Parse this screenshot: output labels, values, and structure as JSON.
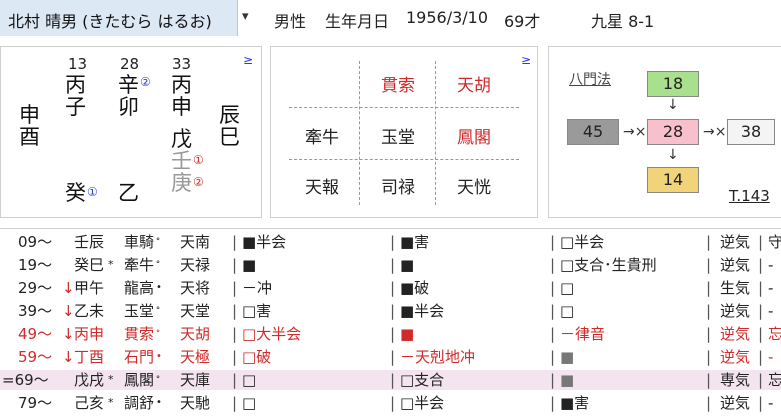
{
  "header": {
    "name": "北村 晴男 (きたむら はるお)",
    "gender": "男性",
    "birth_label": "生年月日",
    "birth_date": "1956/3/10",
    "age": "69才",
    "kyusei": "九星 8-1"
  },
  "meishiki": {
    "col1": {
      "num": "13",
      "ten": "丙",
      "chi": "子",
      "zokan": "癸",
      "mark": "①"
    },
    "col2": {
      "num": "28",
      "ten": "辛",
      "ten_mark": "②",
      "chi": "卯",
      "zokan": "乙"
    },
    "col3": {
      "num": "33",
      "ten": "丙",
      "chi": "申",
      "z1": "戊",
      "z2": "壬",
      "z2_mark": "①",
      "z3": "庚",
      "z3_mark": "②"
    },
    "kubou_left": [
      "申",
      "酉"
    ],
    "kubou_right": [
      "辰",
      "巳"
    ],
    "link_mark": "≥"
  },
  "jintai": {
    "row1": [
      "",
      "貫索",
      "天胡"
    ],
    "row2": [
      "牽牛",
      "玉堂",
      "鳳閣"
    ],
    "row3": [
      "天報",
      "司禄",
      "天恍"
    ],
    "link_mark": "≥"
  },
  "hachimon": {
    "label": "八門法",
    "top": "18",
    "left": "45",
    "center": "28",
    "right": "38",
    "bottom": "14",
    "link": "T.143",
    "arrow_h": "→×",
    "arrow_v": "↓"
  },
  "colors": {
    "accent_green": "#a8e08e",
    "accent_pink": "#f7c0cc",
    "accent_gray": "#9a9a9a",
    "accent_yellow": "#f1d47a",
    "highlight": "#f3e4ef"
  },
  "taiun": [
    {
      "age": "09〜",
      "arrow": "",
      "kanshi": "壬辰",
      "star1": "車騎",
      "m1": "ᐤ",
      "star2": "天南",
      "c1": "■半会",
      "c2": "■害",
      "c3": "□半会",
      "c4": "逆気",
      "c5": "守"
    },
    {
      "age": "19〜",
      "arrow": "",
      "kanshi": "癸巳",
      "k_mark": "*",
      "star1": "牽牛",
      "m1": "ᐤ",
      "star2": "天禄",
      "c1": "■",
      "c2": "■",
      "c3": "□支合･生貴刑",
      "c4": "逆気",
      "c5": "-"
    },
    {
      "age": "29〜",
      "arrow": "↓",
      "kanshi": "甲午",
      "star1": "龍高",
      "m1": "•",
      "star2": "天将",
      "c1": "－冲",
      "c2": "■破",
      "c3": "□",
      "c4": "生気",
      "c5": "-"
    },
    {
      "age": "39〜",
      "arrow": "↓",
      "kanshi": "乙未",
      "star1": "玉堂",
      "m1": "ᐤ",
      "star2": "天堂",
      "c1": "□害",
      "c2": "■半会",
      "c3": "□",
      "c4": "逆気",
      "c5": "-"
    },
    {
      "age": "49〜",
      "arrow": "↓",
      "kanshi": "丙申",
      "star1": "貫索",
      "m1": "ᐤ",
      "star2": "天胡",
      "c1": "□大半会",
      "c2": "■",
      "c3": "－律音",
      "c4": "逆気",
      "c5": "忘"
    },
    {
      "age": "59〜",
      "arrow": "↓",
      "kanshi": "丁酉",
      "star1": "石門",
      "m1": "•",
      "star2": "天極",
      "c1": "□破",
      "c2": "－天剋地冲",
      "c3": "■",
      "c4": "逆気",
      "c5": "-"
    },
    {
      "age": "=69〜",
      "arrow": "",
      "kanshi": "戊戌",
      "k_mark": "*",
      "star1": "鳳閣",
      "m1": "ᐤ",
      "star2": "天庫",
      "c1": "□",
      "c2": "□支合",
      "c3": "■",
      "c4": "専気",
      "c5": "忘"
    },
    {
      "age": "79〜",
      "arrow": "",
      "kanshi": "己亥",
      "k_mark": "*",
      "star1": "調舒",
      "m1": "•",
      "star2": "天馳",
      "c1": "□",
      "c2": "□半会",
      "c3": "■害",
      "c4": "逆気",
      "c5": "-"
    }
  ]
}
